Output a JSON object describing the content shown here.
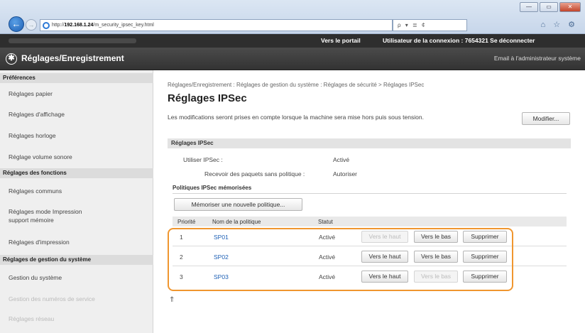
{
  "browser": {
    "url_prefix": "http://",
    "url_host": "192.168.1.24",
    "url_path": "/m_security_ipsec_key.html",
    "search_tools": "ρ ▾ ≣ ¢",
    "window_min": "—",
    "window_max": "▭",
    "window_close": "✕",
    "right_icons": "⌂ ☆ ⚙"
  },
  "topbar": {
    "portal": "Vers le portail",
    "user": "Utilisateur de la connexion :  7654321  Se déconnecter"
  },
  "header": {
    "title": "Réglages/Enregistrement",
    "email": "Email à l'administrateur système"
  },
  "sidebar": {
    "section1": "Préférences",
    "items1": [
      "Réglages papier",
      "Réglages d'affichage",
      "Réglages horloge",
      "Réglage volume sonore"
    ],
    "section2": "Réglages des fonctions",
    "items2": [
      "Réglages communs",
      "Réglages mode Impression",
      "support mémoire",
      "Réglages d'impression"
    ],
    "section3": "Réglages de gestion du système",
    "items3": [
      "Gestion du système",
      "Gestion des numéros de service",
      "Réglages réseau"
    ]
  },
  "main": {
    "breadcrumb": "Réglages/Enregistrement : Réglages de gestion du système : Réglages de sécurité > Réglages IPSec",
    "title": "Réglages IPSec",
    "notice": "Les modifications seront prises en compte lorsque la machine sera mise hors puis sous tension.",
    "modify_button": "Modifier...",
    "section_title": "Réglages IPSec",
    "use_label": "Utiliser IPSec :",
    "use_value": "Activé",
    "receive_label": "Recevoir des paquets sans politique :",
    "receive_value": "Autoriser",
    "policies_title": "Politiques IPSec mémorisées",
    "register_button": "Mémoriser une nouvelle politique...",
    "col_priority": "Priorité",
    "col_name": "Nom de la politique",
    "col_status": "Statut",
    "rows": [
      {
        "priority": "1",
        "name": "SP01",
        "status": "Activé",
        "up": "Vers le haut",
        "down": "Vers le bas",
        "delete": "Supprimer"
      },
      {
        "priority": "2",
        "name": "SP02",
        "status": "Activé",
        "up": "Vers le haut",
        "down": "Vers le bas",
        "delete": "Supprimer"
      },
      {
        "priority": "3",
        "name": "SP03",
        "status": "Activé",
        "up": "Vers le haut",
        "down": "Vers le bas",
        "delete": "Supprimer"
      }
    ],
    "highlight_color": "#f0962f"
  }
}
